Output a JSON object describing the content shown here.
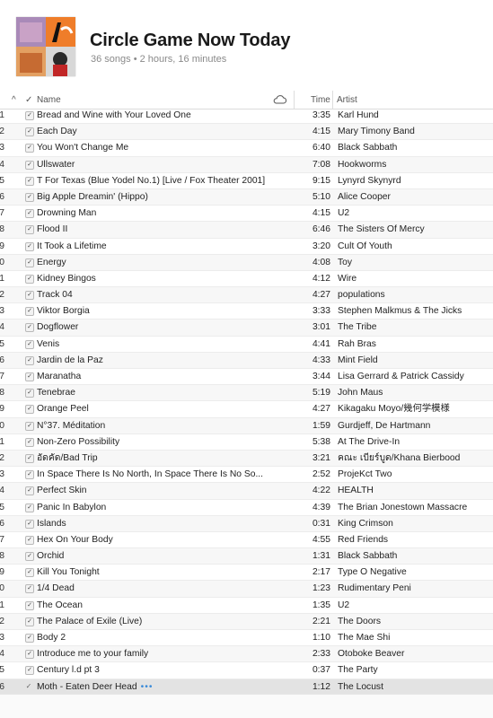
{
  "playlist": {
    "title": "Circle Game Now Today",
    "subtitle": "36 songs • 2 hours, 16 minutes"
  },
  "columns": {
    "sort_arrow": "^",
    "check": "✓",
    "name": "Name",
    "time": "Time",
    "artist": "Artist"
  },
  "icons": {
    "cloud": "cloud-icon",
    "checkbox": "checkbox-icon",
    "now_playing": "now-playing-icon"
  },
  "rows": [
    {
      "num": "1",
      "name": "Bread and Wine with Your Loved One",
      "time": "3:35",
      "artist": "Karl Hund"
    },
    {
      "num": "2",
      "name": "Each Day",
      "time": "4:15",
      "artist": "Mary Timony Band"
    },
    {
      "num": "3",
      "name": "You Won't Change Me",
      "time": "6:40",
      "artist": "Black Sabbath"
    },
    {
      "num": "4",
      "name": "Ullswater",
      "time": "7:08",
      "artist": "Hookworms"
    },
    {
      "num": "5",
      "name": "T For Texas (Blue Yodel No.1) [Live / Fox Theater 2001]",
      "time": "9:15",
      "artist": "Lynyrd Skynyrd"
    },
    {
      "num": "6",
      "name": "Big Apple Dreamin' (Hippo)",
      "time": "5:10",
      "artist": "Alice Cooper"
    },
    {
      "num": "7",
      "name": "Drowning Man",
      "time": "4:15",
      "artist": "U2"
    },
    {
      "num": "8",
      "name": "Flood II",
      "time": "6:46",
      "artist": "The Sisters Of Mercy"
    },
    {
      "num": "9",
      "name": "It Took a Lifetime",
      "time": "3:20",
      "artist": "Cult Of Youth"
    },
    {
      "num": "0",
      "name": "Energy",
      "time": "4:08",
      "artist": "Toy"
    },
    {
      "num": "1",
      "name": "Kidney Bingos",
      "time": "4:12",
      "artist": "Wire"
    },
    {
      "num": "2",
      "name": "Track 04",
      "time": "4:27",
      "artist": "populations"
    },
    {
      "num": "3",
      "name": "Viktor Borgia",
      "time": "3:33",
      "artist": "Stephen Malkmus & The Jicks"
    },
    {
      "num": "4",
      "name": "Dogflower",
      "time": "3:01",
      "artist": "The Tribe"
    },
    {
      "num": "5",
      "name": "Venis",
      "time": "4:41",
      "artist": "Rah Bras"
    },
    {
      "num": "6",
      "name": "Jardin de la Paz",
      "time": "4:33",
      "artist": "Mint Field"
    },
    {
      "num": "7",
      "name": "Maranatha",
      "time": "3:44",
      "artist": "Lisa Gerrard & Patrick Cassidy"
    },
    {
      "num": "8",
      "name": "Tenebrae",
      "time": "5:19",
      "artist": "John Maus"
    },
    {
      "num": "9",
      "name": "Orange Peel",
      "time": "4:27",
      "artist": "Kikagaku Moyo/幾何学模様"
    },
    {
      "num": "0",
      "name": "N°37. Méditation",
      "time": "1:59",
      "artist": "Gurdjeff, De Hartmann"
    },
    {
      "num": "1",
      "name": "Non-Zero Possibility",
      "time": "5:38",
      "artist": "At The Drive-In"
    },
    {
      "num": "2",
      "name": "อัดคัด/Bad Trip",
      "time": "3:21",
      "artist": "คณะ เบียร์บูด/Khana Bierbood"
    },
    {
      "num": "3",
      "name": "In Space There Is No North, In Space There Is No So...",
      "time": "2:52",
      "artist": "ProjeKct Two"
    },
    {
      "num": "4",
      "name": "Perfect Skin",
      "time": "4:22",
      "artist": "HEALTH"
    },
    {
      "num": "5",
      "name": "Panic In Babylon",
      "time": "4:39",
      "artist": "The Brian Jonestown Massacre"
    },
    {
      "num": "6",
      "name": "Islands",
      "time": "0:31",
      "artist": "King Crimson"
    },
    {
      "num": "7",
      "name": "Hex On Your Body",
      "time": "4:55",
      "artist": "Red Friends"
    },
    {
      "num": "8",
      "name": "Orchid",
      "time": "1:31",
      "artist": "Black Sabbath"
    },
    {
      "num": "9",
      "name": "Kill You Tonight",
      "time": "2:17",
      "artist": "Type O Negative"
    },
    {
      "num": "0",
      "name": "1/4 Dead",
      "time": "1:23",
      "artist": "Rudimentary Peni"
    },
    {
      "num": "1",
      "name": "The Ocean",
      "time": "1:35",
      "artist": "U2"
    },
    {
      "num": "2",
      "name": "The Palace of Exile (Live)",
      "time": "2:21",
      "artist": "The Doors"
    },
    {
      "num": "3",
      "name": "Body 2",
      "time": "1:10",
      "artist": "The Mae Shi"
    },
    {
      "num": "4",
      "name": "Introduce me to your family",
      "time": "2:33",
      "artist": "Otoboke Beaver"
    },
    {
      "num": "5",
      "name": "Century l.d pt 3",
      "time": "0:37",
      "artist": "The Party"
    },
    {
      "num": "6",
      "name": "Moth - Eaten Deer Head",
      "time": "1:12",
      "artist": "The Locust",
      "playing": true,
      "dots": "•••"
    }
  ]
}
